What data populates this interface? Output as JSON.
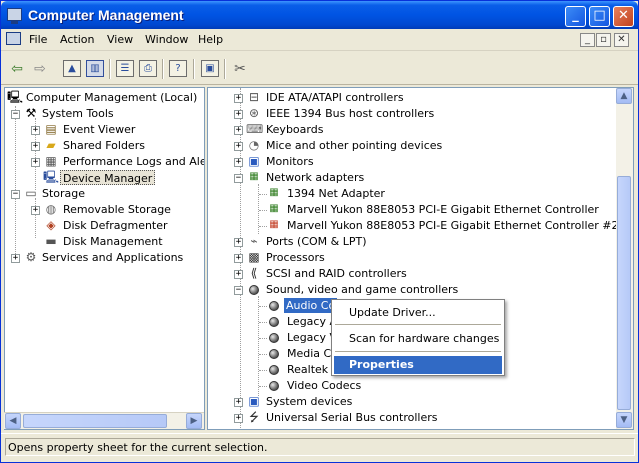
{
  "window": {
    "title": "Computer Management",
    "min": "_",
    "max": "□",
    "close": "✕"
  },
  "menu": {
    "items": [
      "File",
      "Action",
      "View",
      "Window",
      "Help"
    ],
    "mdi_min": "_",
    "mdi_restore": "▫",
    "mdi_close": "✕"
  },
  "toolbar": {
    "back": "⇦",
    "forward": "⇨"
  },
  "left_tree": [
    {
      "label": "Computer Management (Local)",
      "icon": "computer-icon"
    },
    {
      "label": "System Tools",
      "icon": "tools-icon"
    },
    {
      "label": "Event Viewer",
      "icon": "event-viewer-icon"
    },
    {
      "label": "Shared Folders",
      "icon": "shared-folder-icon"
    },
    {
      "label": "Performance Logs and Alerts",
      "icon": "performance-icon"
    },
    {
      "label": "Device Manager",
      "icon": "device-manager-icon"
    },
    {
      "label": "Storage",
      "icon": "storage-icon"
    },
    {
      "label": "Removable Storage",
      "icon": "removable-storage-icon"
    },
    {
      "label": "Disk Defragmenter",
      "icon": "defrag-icon"
    },
    {
      "label": "Disk Management",
      "icon": "disk-management-icon"
    },
    {
      "label": "Services and Applications",
      "icon": "services-icon"
    }
  ],
  "right_tree": [
    {
      "label": "IDE ATA/ATAPI controllers",
      "icon": "ide-icon"
    },
    {
      "label": "IEEE 1394 Bus host controllers",
      "icon": "ieee1394-icon"
    },
    {
      "label": "Keyboards",
      "icon": "keyboard-icon"
    },
    {
      "label": "Mice and other pointing devices",
      "icon": "mouse-icon"
    },
    {
      "label": "Monitors",
      "icon": "monitor-icon"
    },
    {
      "label": "Network adapters",
      "icon": "network-adapter-icon"
    },
    {
      "label": "1394 Net Adapter",
      "icon": "network-card-icon"
    },
    {
      "label": "Marvell Yukon 88E8053 PCI-E Gigabit Ethernet Controller",
      "icon": "network-card-icon"
    },
    {
      "label": "Marvell Yukon 88E8053 PCI-E Gigabit Ethernet Controller #2",
      "icon": "network-card-warning-icon"
    },
    {
      "label": "Ports (COM & LPT)",
      "icon": "port-icon"
    },
    {
      "label": "Processors",
      "icon": "processor-icon"
    },
    {
      "label": "SCSI and RAID controllers",
      "icon": "scsi-icon"
    },
    {
      "label": "Sound, video and game controllers",
      "icon": "sound-icon"
    },
    {
      "label": "Audio Co",
      "icon": "audio-icon"
    },
    {
      "label": "Legacy A",
      "icon": "audio-icon"
    },
    {
      "label": "Legacy V",
      "icon": "audio-icon"
    },
    {
      "label": "Media Co",
      "icon": "audio-icon"
    },
    {
      "label": "Realtek H",
      "icon": "audio-icon"
    },
    {
      "label": "Video Codecs",
      "icon": "audio-icon"
    },
    {
      "label": "System devices",
      "icon": "system-devices-icon"
    },
    {
      "label": "Universal Serial Bus controllers",
      "icon": "usb-icon"
    }
  ],
  "context_menu": {
    "update_driver": "Update Driver...",
    "scan": "Scan for hardware changes",
    "properties": "Properties"
  },
  "status": {
    "text": "Opens property sheet for the current selection."
  },
  "colors": {
    "selection": "#316ac5",
    "title_bar": "#0054e3",
    "chrome": "#ece9d8"
  }
}
